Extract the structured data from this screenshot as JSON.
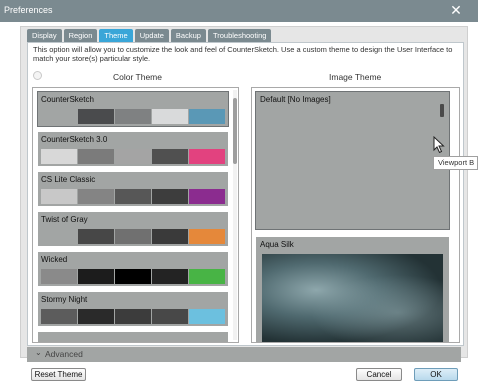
{
  "window": {
    "title": "Preferences",
    "close_glyph": "✕"
  },
  "tabs": [
    {
      "label": "Display",
      "active": false
    },
    {
      "label": "Region",
      "active": false
    },
    {
      "label": "Theme",
      "active": true
    },
    {
      "label": "Update",
      "active": false
    },
    {
      "label": "Backup",
      "active": false
    },
    {
      "label": "Troubleshooting",
      "active": false
    }
  ],
  "description": "This option will allow you to customize the look and feel of CounterSketch.  Use a custom theme to design the User Interface to match your store(s) particular style.",
  "color_theme": {
    "heading": "Color Theme",
    "themes": [
      {
        "name": "CounterSketch",
        "selected": true,
        "swatches": [
          "#a2a5a4",
          "#4a4b4d",
          "#7f8182",
          "#d9dadb",
          "#5a98b6"
        ]
      },
      {
        "name": "CounterSketch 3.0",
        "selected": false,
        "swatches": [
          "#d8d8d8",
          "#7b7b7b",
          "#a4a4a4",
          "#505050",
          "#e2427f"
        ]
      },
      {
        "name": "CS Lite Classic",
        "selected": false,
        "swatches": [
          "#c8c8c8",
          "#848484",
          "#575757",
          "#3d3d3d",
          "#8b2c8f"
        ]
      },
      {
        "name": "Twist of Gray",
        "selected": false,
        "swatches": [
          "#a2a5a4",
          "#474747",
          "#707070",
          "#3a3a3a",
          "#e5883a"
        ]
      },
      {
        "name": "Wicked",
        "selected": false,
        "swatches": [
          "#8a8a8a",
          "#1c1c1c",
          "#000000",
          "#232323",
          "#48b445"
        ]
      },
      {
        "name": "Stormy Night",
        "selected": false,
        "swatches": [
          "#5c5c5c",
          "#2a2a2a",
          "#3c3c3c",
          "#484848",
          "#6cc0df"
        ]
      }
    ]
  },
  "image_theme": {
    "heading": "Image Theme",
    "items": [
      {
        "name": "Default [No Images]",
        "selected": true
      },
      {
        "name": "Aqua Silk",
        "selected": false
      }
    ],
    "tooltip": "Viewport B"
  },
  "advanced": {
    "label": "Advanced",
    "chevron": "⌄"
  },
  "buttons": {
    "reset": "Reset Theme",
    "cancel": "Cancel",
    "ok": "OK"
  }
}
